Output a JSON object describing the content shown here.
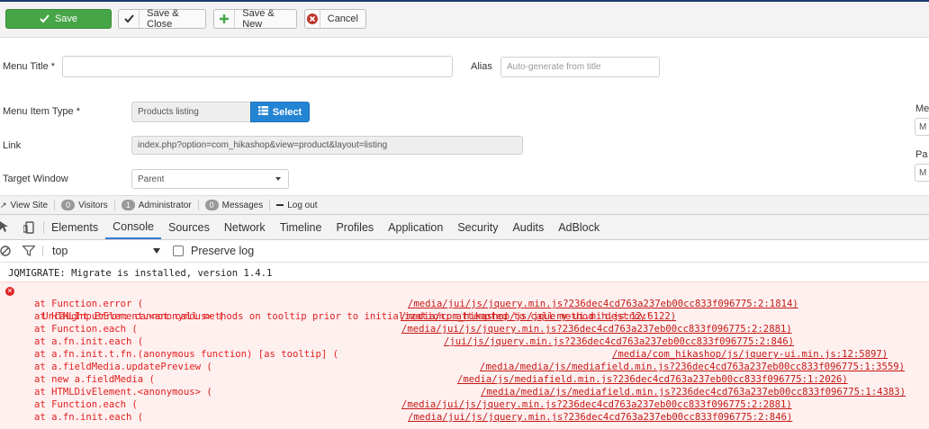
{
  "toolbar": {
    "save": "Save",
    "save_close": "Save & Close",
    "save_new": "Save & New",
    "cancel": "Cancel"
  },
  "form": {
    "menu_title_label": "Menu Title *",
    "menu_title_value": "",
    "alias_label": "Alias",
    "alias_placeholder": "Auto-generate from title",
    "menu_item_type_label": "Menu Item Type *",
    "menu_item_type_value": "Products listing",
    "select_button": "Select",
    "link_label": "Link",
    "link_value": "index.php?option=com_hikashop&view=product&layout=listing",
    "target_window_label": "Target Window",
    "target_window_value": "Parent",
    "right_label_1": "Me",
    "right_input_1": "M",
    "right_label_2": "Pa",
    "right_input_2": "M"
  },
  "statusbar": {
    "view_site": "View Site",
    "visitors_count": "0",
    "visitors": "Visitors",
    "admins_count": "1",
    "admins": "Administrator",
    "messages_count": "0",
    "messages": "Messages",
    "logout": "Log out"
  },
  "devtools": {
    "tabs": [
      "Elements",
      "Console",
      "Sources",
      "Network",
      "Timeline",
      "Profiles",
      "Application",
      "Security",
      "Audits",
      "AdBlock"
    ],
    "context": "top",
    "preserve_log": "Preserve log"
  },
  "console": {
    "info": "JQMIGRATE: Migrate is installed, version 1.4.1",
    "error": "Uncaught Error: cannot call methods on tooltip prior to initialization; attempted to call method 'destroy'",
    "trace": [
      {
        "fn": "at Function.error (",
        "src": "/media/jui/js/jquery.min.js?236dec4cd763a237eb00cc833f096775:2:1814)"
      },
      {
        "fn": "at HTMLInputElement.<anonymous> (",
        "src": "/media/com_hikashop/js/jquery-ui.min.js:12:6122)"
      },
      {
        "fn": "at Function.each (",
        "src": "/media/jui/js/jquery.min.js?236dec4cd763a237eb00cc833f096775:2:2881)"
      },
      {
        "fn": "at a.fn.init.each (",
        "src": "/jui/js/jquery.min.js?236dec4cd763a237eb00cc833f096775:2:846)"
      },
      {
        "fn": "at a.fn.init.t.fn.(anonymous function) [as tooltip] (",
        "src": "/media/com_hikashop/js/jquery-ui.min.js:12:5897)"
      },
      {
        "fn": "at a.fieldMedia.updatePreview (",
        "src": "/media/media/js/mediafield.min.js?236dec4cd763a237eb00cc833f096775:1:3559)"
      },
      {
        "fn": "at new a.fieldMedia (",
        "src": "/media/js/mediafield.min.js?236dec4cd763a237eb00cc833f096775:1:2026)"
      },
      {
        "fn": "at HTMLDivElement.<anonymous> (",
        "src": "/media/media/js/mediafield.min.js?236dec4cd763a237eb00cc833f096775:1:4383)"
      },
      {
        "fn": "at Function.each (",
        "src": "/media/jui/js/jquery.min.js?236dec4cd763a237eb00cc833f096775:2:2881)"
      },
      {
        "fn": "at a.fn.init.each (",
        "src": "/media/jui/js/jquery.min.js?236dec4cd763a237eb00cc833f096775:2:846)"
      }
    ]
  },
  "colors": {
    "save_green": "#46a546",
    "select_blue": "#2384d3",
    "error_red": "#e02020",
    "error_bg": "#fff0f0"
  }
}
